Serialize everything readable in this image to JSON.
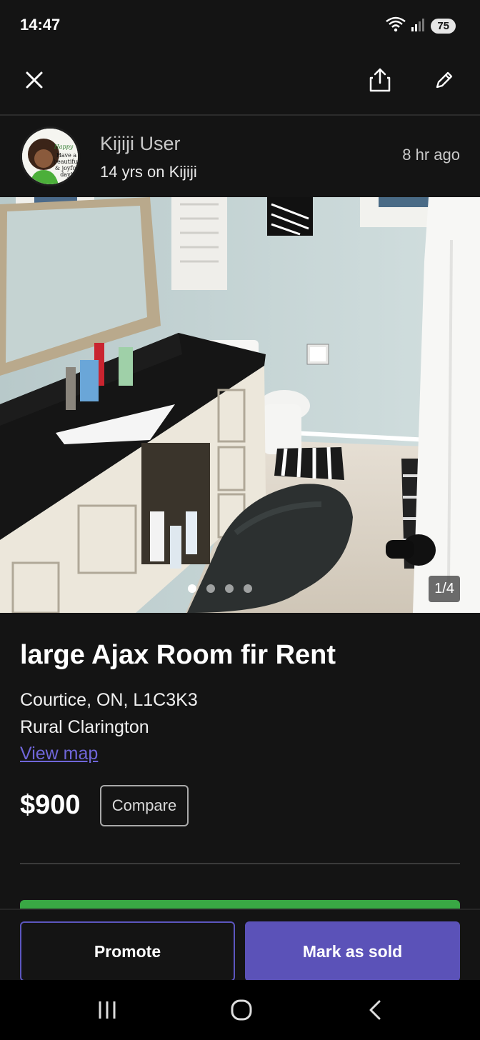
{
  "status_bar": {
    "time": "14:47",
    "battery": "75"
  },
  "seller": {
    "name": "Kijiji User",
    "tenure": "14 yrs on Kijiji",
    "posted": "8 hr  ago",
    "avatar_text": "Have a beautiful & joyful day!"
  },
  "gallery": {
    "counter": "1/4",
    "total_images": 4,
    "current_index": 1
  },
  "listing": {
    "title": "large Ajax Room fir Rent",
    "location": "Courtice, ON, L1C3K3",
    "area": "Rural Clarington",
    "map_link": "View map",
    "price": "$900",
    "compare_label": "Compare"
  },
  "actions": {
    "promote_label": "Promote",
    "mark_sold_label": "Mark as sold"
  },
  "colors": {
    "accent": "#5b52b8",
    "link": "#6f66d8",
    "green": "#39a844",
    "background": "#141414"
  }
}
